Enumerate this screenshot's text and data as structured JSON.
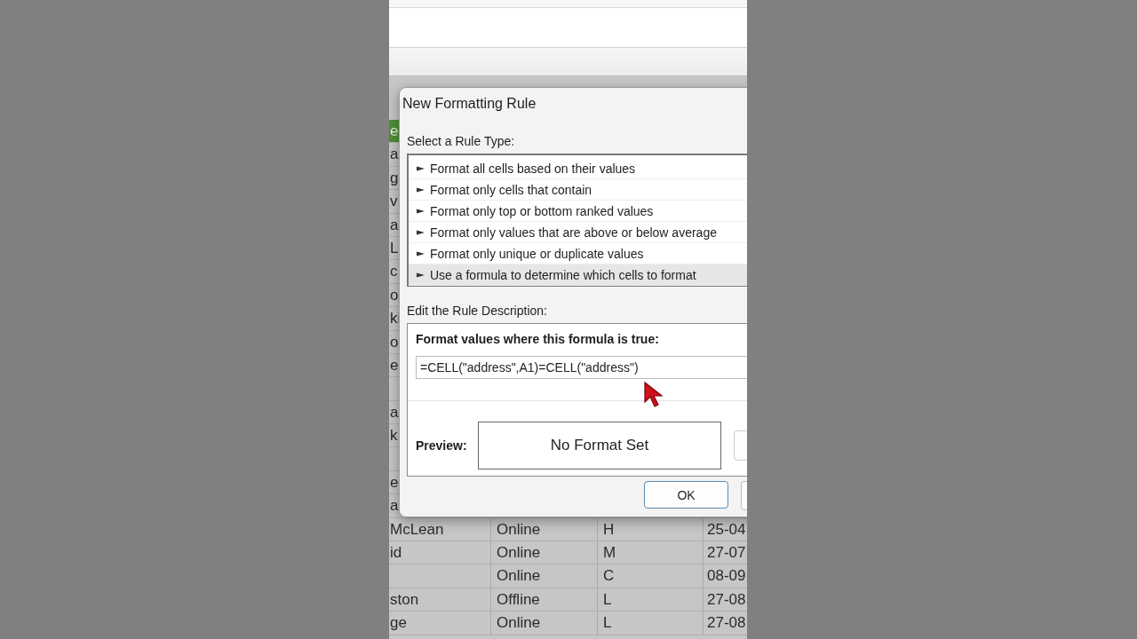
{
  "sheet": {
    "rows": [
      {
        "kind": "header",
        "column_1": "e"
      },
      {
        "kind": "data",
        "column_1": "a"
      },
      {
        "kind": "data",
        "column_1": "g"
      },
      {
        "kind": "data",
        "column_1": "v"
      },
      {
        "kind": "data",
        "column_1": "a"
      },
      {
        "kind": "data",
        "column_1": "L"
      },
      {
        "kind": "data",
        "column_1": "c"
      },
      {
        "kind": "data",
        "column_1": "o"
      },
      {
        "kind": "data",
        "column_1": "ki"
      },
      {
        "kind": "data",
        "column_1": "o"
      },
      {
        "kind": "data",
        "column_1": "e"
      },
      {
        "kind": "blank"
      },
      {
        "kind": "data",
        "column_1": "a"
      },
      {
        "kind": "data",
        "column_1": "k"
      },
      {
        "kind": "blank"
      },
      {
        "kind": "data",
        "column_1": "e"
      },
      {
        "kind": "data",
        "column_1": "a"
      },
      {
        "kind": "data",
        "column_1": "McLean",
        "column_2": "Online",
        "column_3": "H",
        "column_4": "25-04"
      },
      {
        "kind": "data",
        "column_1": "id",
        "column_2": "Online",
        "column_3": "M",
        "column_4": "27-07"
      },
      {
        "kind": "data",
        "column_2": "Online",
        "column_3": "C",
        "column_4": "08-09"
      },
      {
        "kind": "data",
        "column_1": "ston",
        "column_2": "Offline",
        "column_3": "L",
        "column_4": "27-08"
      },
      {
        "kind": "data",
        "column_1": "ge",
        "column_2": "Online",
        "column_3": "L",
        "column_4": "27-08"
      },
      {
        "kind": "blank"
      }
    ]
  },
  "dialog": {
    "title": "New Formatting Rule",
    "rule_type_label": "Select a Rule Type:",
    "rule_types": [
      {
        "label": "Format all cells based on their values",
        "selected": false
      },
      {
        "label": "Format only cells that contain",
        "selected": false
      },
      {
        "label": "Format only top or bottom ranked values",
        "selected": false
      },
      {
        "label": "Format only values that are above or below average",
        "selected": false
      },
      {
        "label": "Format only unique or duplicate values",
        "selected": false
      },
      {
        "label": "Use a formula to determine which cells to format",
        "selected": true
      }
    ],
    "description_label": "Edit the Rule Description:",
    "formula_label": "Format values where this formula is true:",
    "formula": "=CELL(\"address\",A1)=CELL(\"address\")",
    "preview_label": "Preview:",
    "preview_text": "No Format Set",
    "ok_button": "OK"
  }
}
